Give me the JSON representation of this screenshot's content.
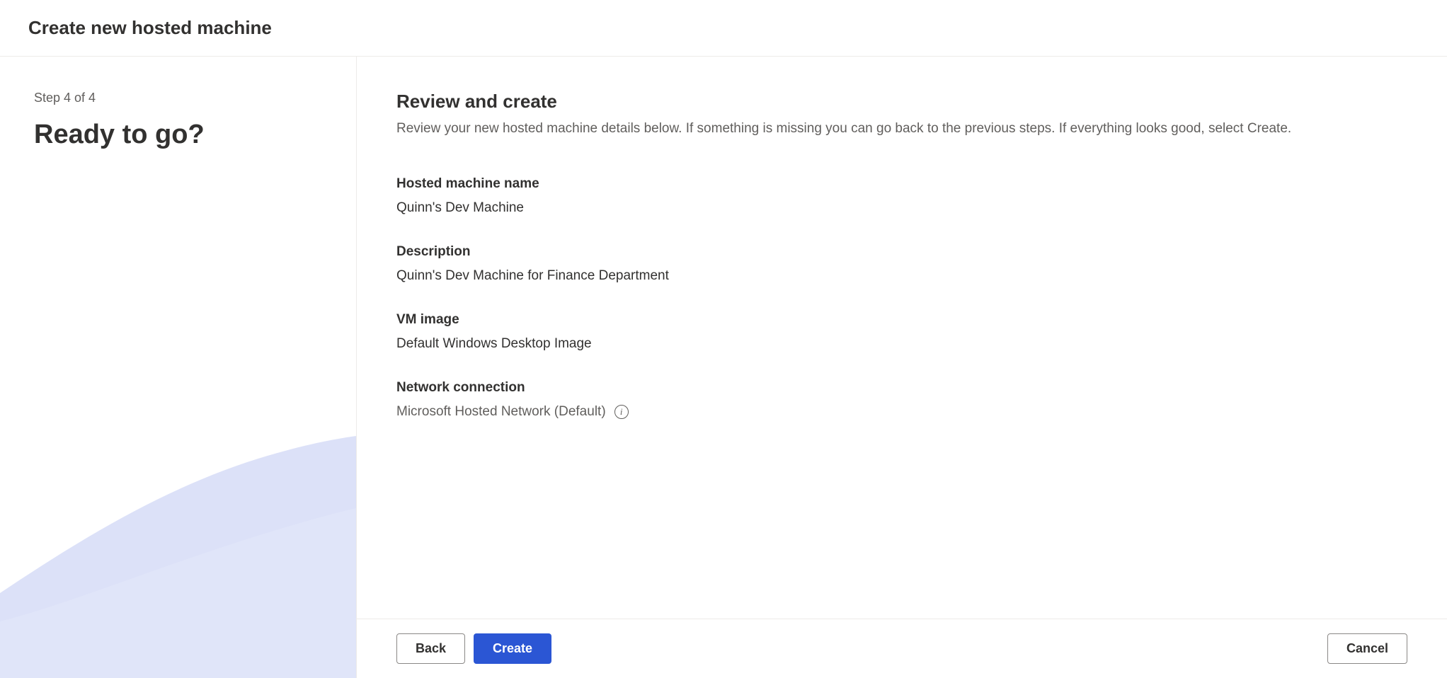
{
  "header": {
    "title": "Create new hosted machine"
  },
  "sidebar": {
    "step_label": "Step 4 of 4",
    "title": "Ready to go?"
  },
  "main": {
    "title": "Review and create",
    "subtitle": "Review your new hosted machine details below. If something is missing you can go back to the previous steps. If everything looks good, select Create.",
    "fields": {
      "name_label": "Hosted machine name",
      "name_value": "Quinn's Dev Machine",
      "description_label": "Description",
      "description_value": "Quinn's Dev Machine for Finance Department",
      "vm_image_label": "VM image",
      "vm_image_value": "Default Windows Desktop Image",
      "network_label": "Network connection",
      "network_value": "Microsoft Hosted Network (Default)"
    }
  },
  "footer": {
    "back_label": "Back",
    "create_label": "Create",
    "cancel_label": "Cancel"
  }
}
